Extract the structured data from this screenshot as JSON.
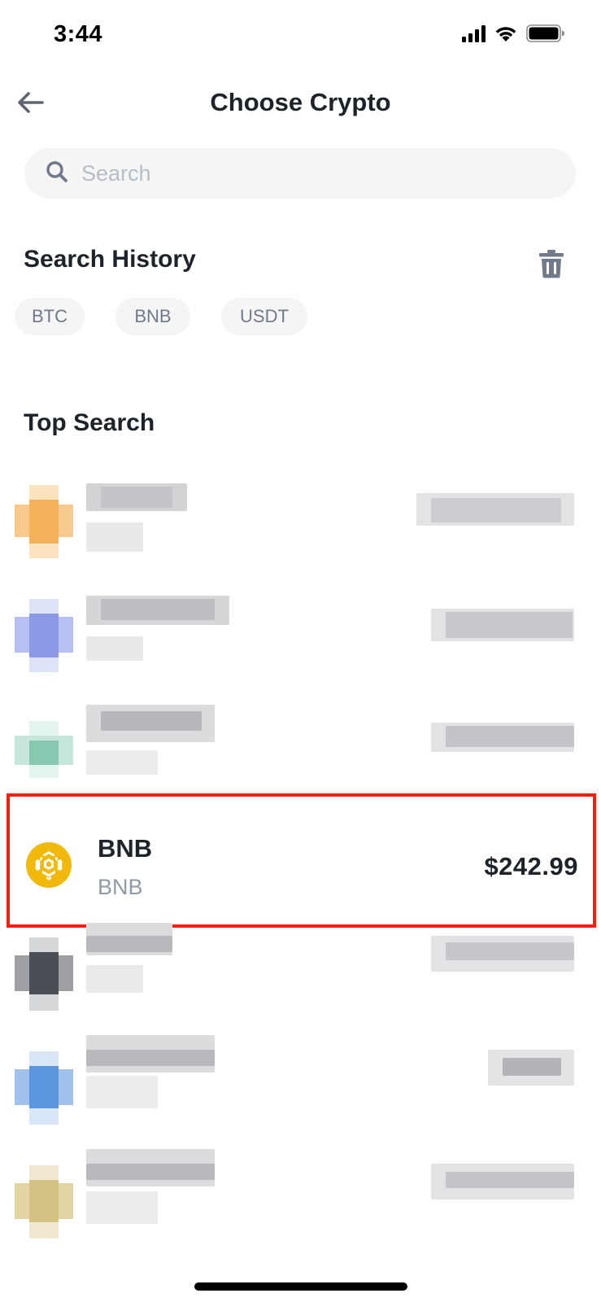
{
  "status_bar": {
    "time": "3:44",
    "icons": [
      "cellular-signal-icon",
      "wifi-icon",
      "battery-icon"
    ]
  },
  "header": {
    "title": "Choose Crypto",
    "back_icon": "back-arrow-icon"
  },
  "search": {
    "placeholder": "Search",
    "value": "",
    "icon": "search-icon"
  },
  "search_history": {
    "title": "Search History",
    "clear_icon": "trash-icon",
    "chips": [
      "BTC",
      "BNB",
      "USDT"
    ]
  },
  "top_search": {
    "title": "Top Search",
    "highlighted": {
      "symbol": "BNB",
      "name": "BNB",
      "price": "$242.99",
      "icon": "bnb-logo-icon"
    }
  },
  "colors": {
    "accent_yellow": "#f0b90b",
    "highlight_border": "#f41f0b",
    "text_primary": "#1e2329",
    "text_secondary": "#929aa5",
    "chip_bg": "#f5f5f5"
  }
}
